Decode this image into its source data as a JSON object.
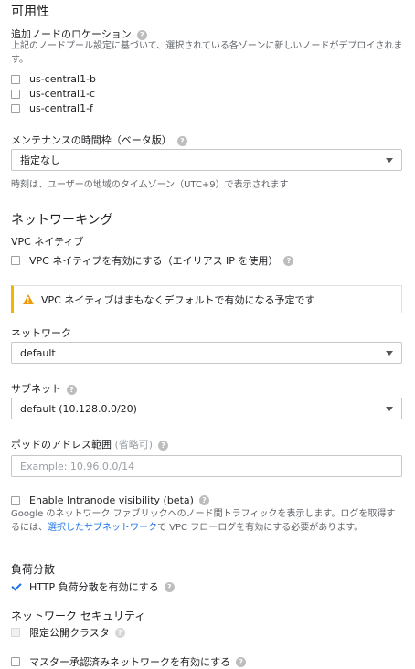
{
  "availability": {
    "title": "可用性",
    "node_locations_label": "追加ノードのロケーション",
    "node_locations_desc": "上記のノードプール設定に基づいて、選択されている各ゾーンに新しいノードがデプロイされます。",
    "zones": [
      "us-central1-b",
      "us-central1-c",
      "us-central1-f"
    ]
  },
  "maintenance": {
    "label": "メンテナンスの時間枠（ベータ版）",
    "value": "指定なし",
    "note": "時刻は、ユーザーの地域のタイムゾーン（UTC+9）で表示されます"
  },
  "networking": {
    "title": "ネットワーキング",
    "vpc_native_label": "VPC ネイティブ",
    "vpc_native_checkbox": "VPC ネイティブを有効にする（エイリアス IP を使用）",
    "warning": "VPC ネイティブはまもなくデフォルトで有効になる予定です",
    "network_label": "ネットワーク",
    "network_value": "default",
    "subnet_label": "サブネット",
    "subnet_value": "default (10.128.0.0/20)",
    "pod_range_label": "ポッドのアドレス範囲",
    "pod_range_optional": "(省略可)",
    "pod_range_placeholder": "Example: 10.96.0.0/14",
    "intranode_label": "Enable Intranode visibility (beta)",
    "intranode_desc_1": "Google のネットワーク ファブリックへのノード間トラフィックを表示します。ログを取得するには、",
    "intranode_link": "選択したサブネットワーク",
    "intranode_desc_2": "で VPC フローログを有効にする必要があります。"
  },
  "load_balancing": {
    "title": "負荷分散",
    "http_label": "HTTP 負荷分散を有効にする",
    "http_checked": true
  },
  "network_security": {
    "title": "ネットワーク セキュリティ",
    "private_cluster_label": "限定公開クラスタ",
    "master_auth_label": "マスター承認済みネットワークを有効にする"
  },
  "colors": {
    "accent": "#1a73e8",
    "warning": "#f4b400",
    "help_icon": "#bdbdbd"
  }
}
